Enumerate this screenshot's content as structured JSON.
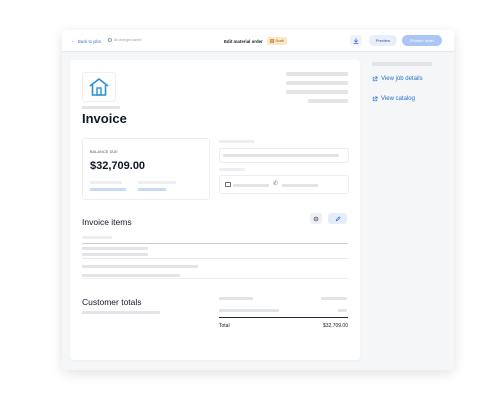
{
  "topbar": {
    "back_label": "Back to jobs",
    "saved_label": "All changes saved",
    "title": "Edit material order",
    "status_badge": "Draft",
    "preview_label": "Preview",
    "finalize_label": "Finalize order"
  },
  "invoice": {
    "title": "Invoice",
    "balance_due_label": "BALANCE DUE",
    "balance_due_value": "$32,709.00"
  },
  "items": {
    "title": "Invoice items"
  },
  "totals": {
    "title": "Customer totals",
    "total_label": "Total",
    "total_value": "$32,709.00"
  },
  "sidebar": {
    "links": [
      {
        "label": "View job details"
      },
      {
        "label": "View catalog"
      }
    ]
  },
  "colors": {
    "accent": "#2a6fd4",
    "logo": "#2a8fd6",
    "draft_badge_bg": "#fde7c6",
    "finalize_bg": "#a9c6f4"
  }
}
